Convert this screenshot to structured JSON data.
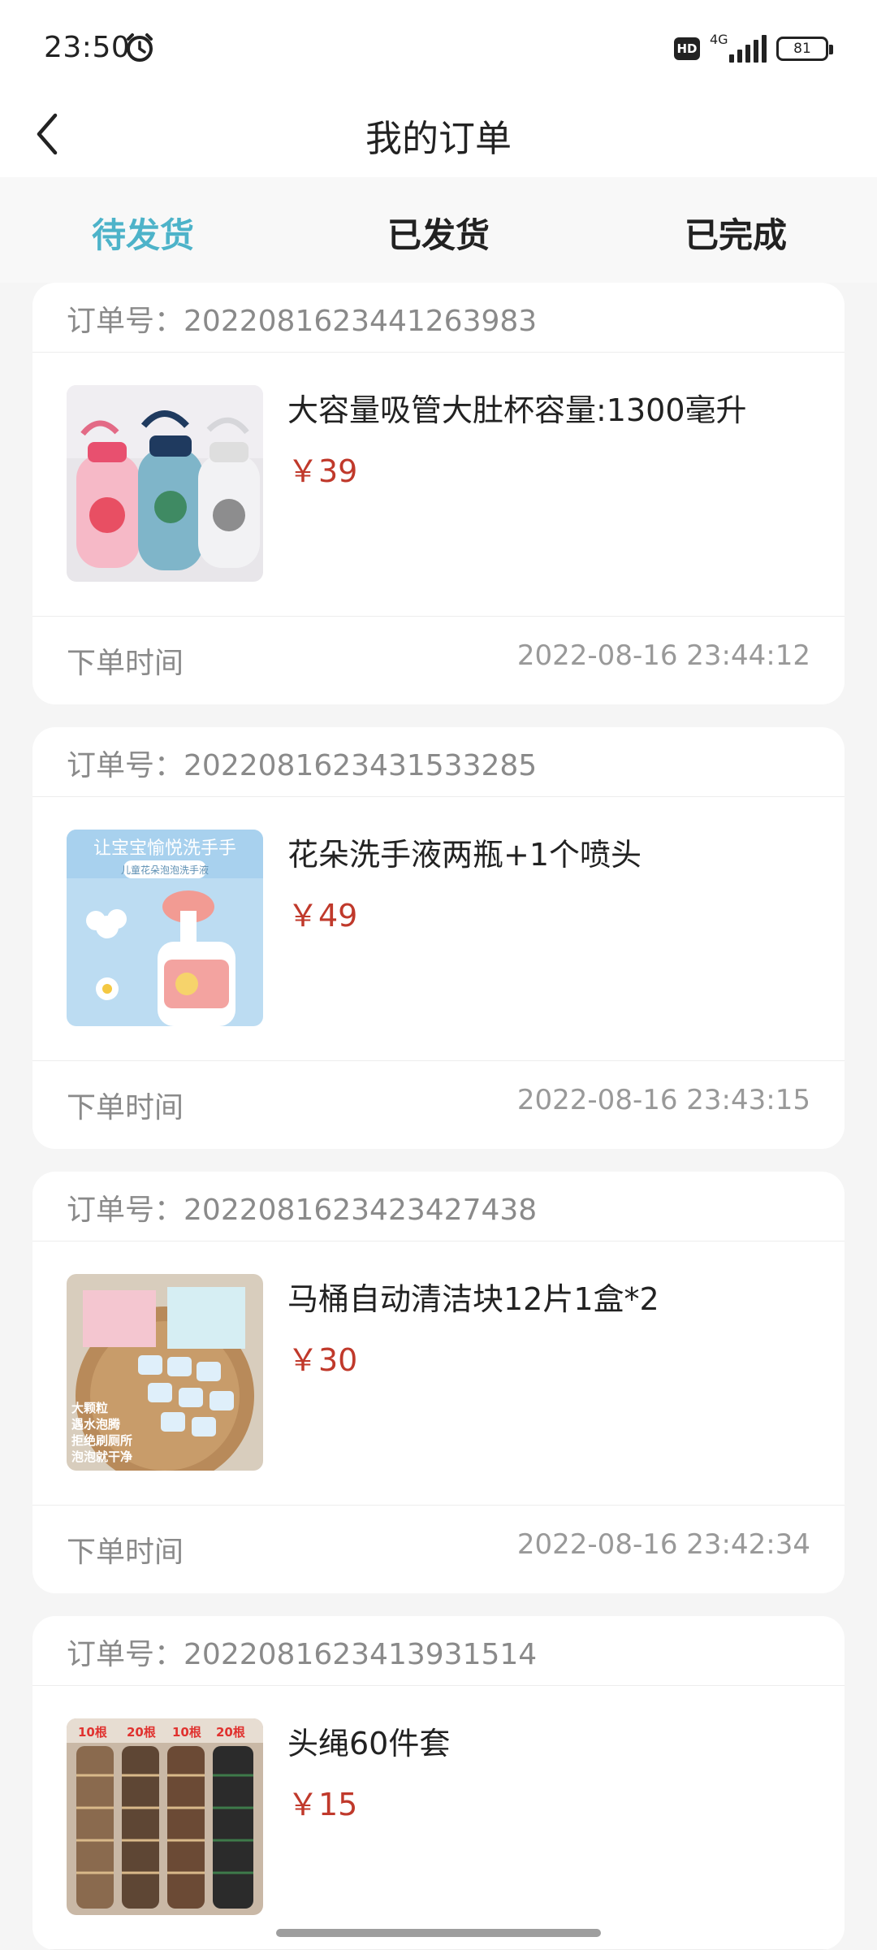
{
  "status_bar": {
    "time": "23:50",
    "alarm_icon": "alarm-icon",
    "hd": "HD",
    "network": "4G",
    "battery": "81"
  },
  "header": {
    "back_icon": "back-arrow-icon",
    "title": "我的订单"
  },
  "tabs": [
    {
      "label": "待发货",
      "active": true
    },
    {
      "label": "已发货",
      "active": false
    },
    {
      "label": "已完成",
      "active": false
    }
  ],
  "order_number_label": "订单号：",
  "order_time_label": "下单时间",
  "orders": [
    {
      "order_no": "2022081623441263983",
      "product": "大容量吸管大肚杯容量:1300毫升",
      "price": "￥39",
      "time": "2022-08-16 23:44:12",
      "image": "water-bottles-image"
    },
    {
      "order_no": "2022081623431533285",
      "product": "花朵洗手液两瓶+1个喷头",
      "price": "￥49",
      "time": "2022-08-16 23:43:15",
      "image": "hand-wash-image",
      "image_text": [
        "让宝宝愉悦洗手手",
        "儿童花朵泡泡洗手液"
      ]
    },
    {
      "order_no": "2022081623423427438",
      "product": "马桶自动清洁块12片1盒*2",
      "price": "￥30",
      "time": "2022-08-16 23:42:34",
      "image": "toilet-cleaner-image",
      "image_text": [
        "大颗粒",
        "遇水泡腾",
        "拒绝刷厕所",
        "泡泡就干净"
      ]
    },
    {
      "order_no": "2022081623413931514",
      "product": "头绳60件套",
      "price": "￥15",
      "image": "hair-ties-image",
      "image_text": [
        "10根",
        "20根",
        "10根",
        "20根"
      ]
    }
  ],
  "colors": {
    "accent": "#4db3c9",
    "price": "#c0392b",
    "background": "#f5f5f5"
  }
}
